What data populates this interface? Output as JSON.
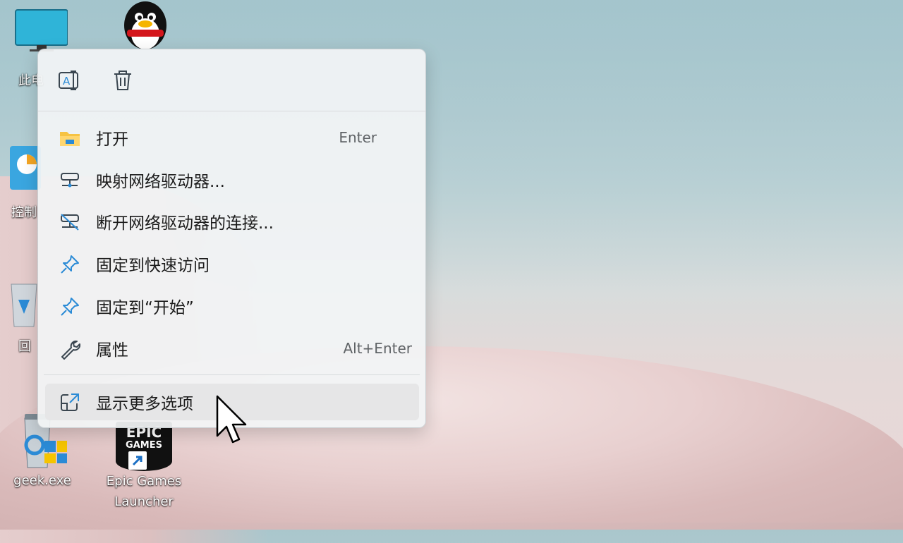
{
  "desktop": {
    "icons": [
      {
        "label": "此电"
      },
      {
        "label": ""
      },
      {
        "label": "控制"
      },
      {
        "label": "回"
      },
      {
        "label": "geek.exe"
      },
      {
        "label": "Epic Games Launcher"
      }
    ],
    "epic_logo": {
      "line1": "EPIC",
      "line2": "GAMES"
    }
  },
  "context_menu": {
    "toolbar": [
      {
        "icon": "rename-icon"
      },
      {
        "icon": "delete-icon"
      }
    ],
    "items": [
      {
        "label": "打开",
        "shortcut": "Enter",
        "icon": "folder-icon"
      },
      {
        "label": "映射网络驱动器...",
        "shortcut": "",
        "icon": "network-drive-icon"
      },
      {
        "label": "断开网络驱动器的连接...",
        "shortcut": "",
        "icon": "disconnect-network-drive-icon"
      },
      {
        "label": "固定到快速访问",
        "shortcut": "",
        "icon": "pin-icon"
      },
      {
        "label": "固定到“开始”",
        "shortcut": "",
        "icon": "pin-icon"
      },
      {
        "label": "属性",
        "shortcut": "Alt+Enter",
        "icon": "wrench-icon"
      },
      {
        "label": "显示更多选项",
        "shortcut": "",
        "icon": "open-external-icon"
      }
    ]
  },
  "colors": {
    "accent": "#2b8bd6",
    "folder": "#f6c343"
  }
}
